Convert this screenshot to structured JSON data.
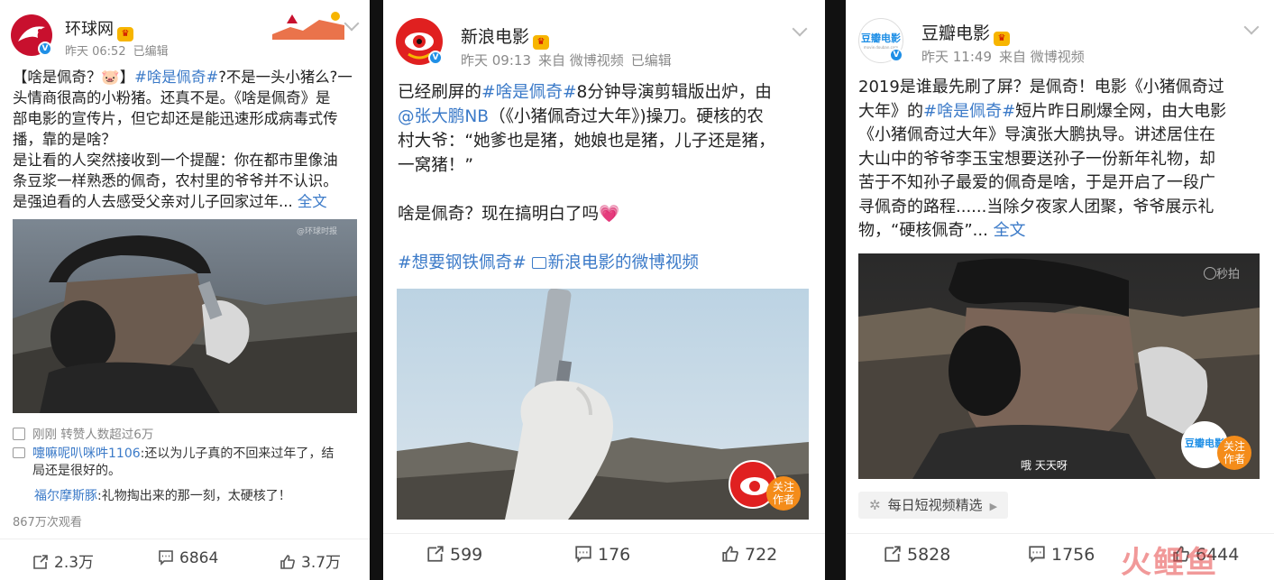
{
  "card1": {
    "name": "环球网",
    "time": "昨天 06:52",
    "edited": "已编辑",
    "text_lines": [
      [
        "【啥是佩奇？🐷】",
        "#啥是佩奇#",
        "?不是一头小猪么?一"
      ],
      [
        "头情商很高的小粉猪。还真不是。《啥是佩奇》是"
      ],
      [
        "部电影的宣传片，但它却还是能迅速形成病毒式传"
      ],
      [
        "播，靠的是啥？"
      ],
      [
        "是让看的人突然接收到一个提醒：你在都市里像油"
      ],
      [
        "条豆浆一样熟悉的佩奇，农村里的爷爷并不认识。"
      ],
      [
        "是强迫看的人去感受父亲对儿子回家过年..."
      ]
    ],
    "more": "全文",
    "like_note": "刚刚 转赞人数超过6万",
    "comments": [
      {
        "user": "嚏嘛呢叭咪吽1106",
        "text": ":还以为儿子真的不回来过年了，结"
      },
      {
        "user": "",
        "text": "局还是很好的。"
      },
      {
        "user": "福尔摩斯豚",
        "text": ":礼物掏出来的那一刻，太硬核了！"
      }
    ],
    "views": "867万次观看",
    "repost": "2.3万",
    "comment": "6864",
    "like": "3.7万",
    "watermark": "@环球时报"
  },
  "card2": {
    "name": "新浪电影",
    "time": "昨天 09:13",
    "source": "来自 微博视频",
    "edited": "已编辑",
    "text_lines": [
      [
        "已经刷屏的",
        "#啥是佩奇#",
        "8分钟导演剪辑版出炉，由"
      ],
      [
        "@张大鹏NB",
        "（《小猪佩奇过大年》)操刀。硬核的农"
      ],
      [
        "村大爷：“她爹也是猪，她娘也是猪，儿子还是猪，"
      ],
      [
        "一窝猪！”"
      ]
    ],
    "line2": "啥是佩奇？现在搞明白了吗💗",
    "tag_line": "#想要钢铁佩奇#",
    "video_link": "新浪电影的微博视频",
    "follow": [
      "关注",
      "作者"
    ],
    "repost": "599",
    "comment": "176",
    "like": "722"
  },
  "card3": {
    "name": "豆瓣电影",
    "avatar_text": "豆瓣电影",
    "avatar_sub": "movie.douban.com",
    "time": "昨天 11:49",
    "source": "来自 微博视频",
    "text_lines": [
      [
        "2019是谁最先刷了屏？是佩奇！电影《小猪佩奇过"
      ],
      [
        "大年》的",
        "#啥是佩奇#",
        "短片昨日刷爆全网，由大电影"
      ],
      [
        "《小猪佩奇过大年》导演张大鹏执导。讲述居住在"
      ],
      [
        "大山中的爷爷李玉宝想要送孙子一份新年礼物，却"
      ],
      [
        "苦于不知孙子最爱的佩奇是啥，于是开启了一段广"
      ],
      [
        "寻佩奇的路程......当除夕夜家人团聚，爷爷展示礼"
      ],
      [
        "物，“硬核佩奇”..."
      ]
    ],
    "more": "全文",
    "video_mark": "秒拍",
    "subtitle": "哦 天天呀",
    "follow": [
      "关注",
      "作者"
    ],
    "topic_chip": "每日短视频精选",
    "repost": "5828",
    "comment": "1756",
    "like": "6444",
    "watermark": "火鲤鱼"
  },
  "colors": {
    "link": "#3b7ac8",
    "follow": "#f48c1a",
    "verified": "#1f8fe6"
  }
}
